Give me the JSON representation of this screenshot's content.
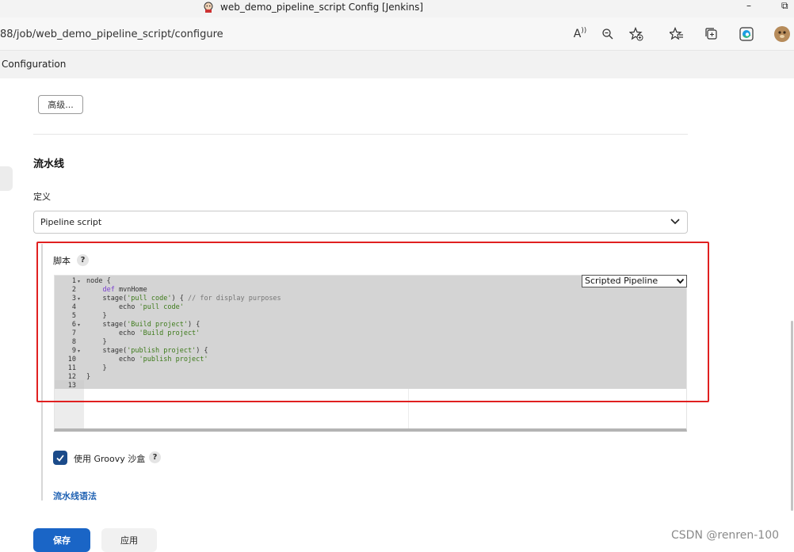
{
  "window": {
    "title": "web_demo_pipeline_script Config [Jenkins]",
    "minimize_glyph": "–",
    "restore_glyph": "⧉"
  },
  "browser": {
    "url": "88/job/web_demo_pipeline_script/configure",
    "read_aloud_label": "A",
    "icons": [
      "read-aloud-icon",
      "zoom-out-icon",
      "favorite-add-icon",
      "favorites-icon",
      "collections-icon",
      "edge-icon",
      "profile-avatar"
    ]
  },
  "breadcrumb": {
    "current": "Configuration"
  },
  "advanced_button": "高级...",
  "pipeline": {
    "section_title": "流水线",
    "definition_label": "定义",
    "definition_value": "Pipeline script",
    "script_label": "脚本",
    "help_glyph": "?",
    "sample_select_value": "Scripted Pipeline",
    "code_lines": [
      {
        "n": "1",
        "fold": true,
        "text": "node {"
      },
      {
        "n": "2",
        "fold": false,
        "text": "    def mvnHome"
      },
      {
        "n": "3",
        "fold": true,
        "text": "    stage('pull code') { // for display purposes"
      },
      {
        "n": "4",
        "fold": false,
        "text": "        echo 'pull code'"
      },
      {
        "n": "5",
        "fold": false,
        "text": "    }"
      },
      {
        "n": "6",
        "fold": true,
        "text": "    stage('Build project') {"
      },
      {
        "n": "7",
        "fold": false,
        "text": "        echo 'Build project'"
      },
      {
        "n": "8",
        "fold": false,
        "text": "    }"
      },
      {
        "n": "9",
        "fold": true,
        "text": "    stage('publish project') {"
      },
      {
        "n": "10",
        "fold": false,
        "text": "        echo 'publish project'"
      },
      {
        "n": "11",
        "fold": false,
        "text": "    }"
      },
      {
        "n": "12",
        "fold": false,
        "text": "}"
      },
      {
        "n": "13",
        "fold": false,
        "text": ""
      }
    ],
    "groovy_sandbox_label": "使用 Groovy 沙盒",
    "groovy_sandbox_checked": true,
    "syntax_link": "流水线语法"
  },
  "actions": {
    "save": "保存",
    "apply": "应用"
  },
  "watermark": "CSDN @renren-100",
  "colors": {
    "primary": "#1a65c6",
    "highlight_border": "#e02020",
    "checkbox": "#1b4b8a"
  }
}
